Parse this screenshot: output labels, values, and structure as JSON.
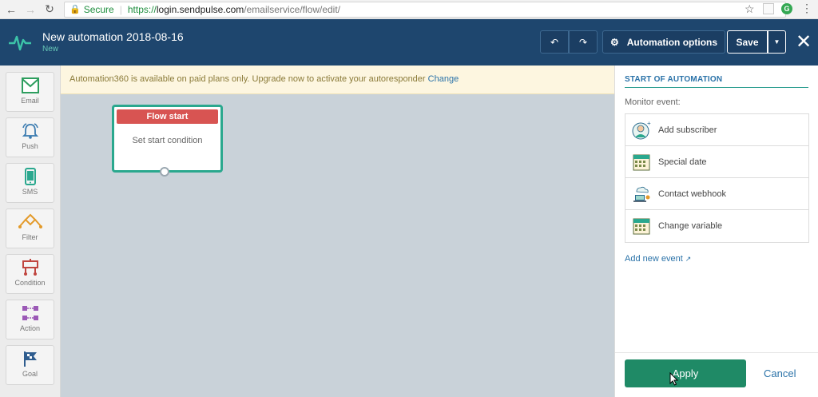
{
  "browser": {
    "secure_label": "Secure",
    "url_proto": "https://",
    "url_host": "login.sendpulse.com",
    "url_path": "/emailservice/flow/edit/"
  },
  "header": {
    "title": "New automation 2018-08-16",
    "subtitle": "New",
    "undo_icon": "undo-icon",
    "redo_icon": "redo-icon",
    "options_label": "Automation options",
    "save_label": "Save"
  },
  "toolbar": {
    "items": [
      {
        "label": "Email",
        "icon": "email-icon"
      },
      {
        "label": "Push",
        "icon": "bell-icon"
      },
      {
        "label": "SMS",
        "icon": "phone-icon"
      },
      {
        "label": "Filter",
        "icon": "filter-icon"
      },
      {
        "label": "Condition",
        "icon": "condition-icon"
      },
      {
        "label": "Action",
        "icon": "action-icon"
      },
      {
        "label": "Goal",
        "icon": "flag-icon"
      }
    ]
  },
  "banner": {
    "text": "Automation360 is available on paid plans only. Upgrade now to activate your autoresponder",
    "link": "Change"
  },
  "flow": {
    "node_title": "Flow start",
    "node_body": "Set start condition"
  },
  "panel": {
    "title": "START OF AUTOMATION",
    "monitor_label": "Monitor event:",
    "events": [
      {
        "label": "Add subscriber",
        "icon": "add-subscriber-icon"
      },
      {
        "label": "Special date",
        "icon": "calendar-icon"
      },
      {
        "label": "Contact webhook",
        "icon": "webhook-icon"
      },
      {
        "label": "Change variable",
        "icon": "calendar-icon"
      }
    ],
    "add_event": "Add new event",
    "apply": "Apply",
    "cancel": "Cancel"
  },
  "colors": {
    "header_bg": "#1e466e",
    "accent_green": "#2aa88e",
    "flow_start_red": "#d85452",
    "apply_green": "#1f8a66",
    "link_blue": "#2a72a8"
  }
}
